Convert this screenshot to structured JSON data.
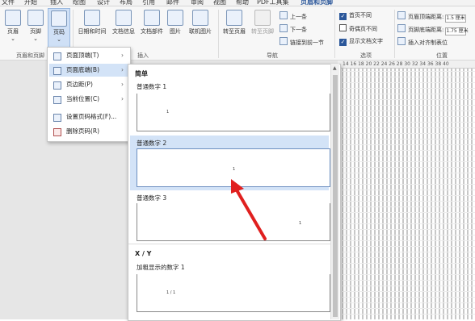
{
  "tabs": [
    "文件",
    "开始",
    "插入",
    "绘图",
    "设计",
    "布局",
    "引用",
    "邮件",
    "审阅",
    "视图",
    "帮助",
    "PDF工具集",
    "页眉和页脚"
  ],
  "ribbon": {
    "header_label": "页眉",
    "footer_label": "页脚",
    "page_number_label": "页码",
    "date_time_label": "日期和时间",
    "doc_info_label": "文档信息",
    "doc_parts_label": "文档部件",
    "picture_label": "图片",
    "online_picture_label": "联机图片",
    "goto_header_label": "转至页眉",
    "goto_footer_label": "转至页脚",
    "prev_label": "上一条",
    "next_label": "下一条",
    "link_prev_label": "链接到前一节",
    "first_page_diff_label": "首页不同",
    "odd_even_diff_label": "奇偶页不同",
    "show_doc_text_label": "显示文档文字",
    "header_top_label": "页眉顶端距离:",
    "header_top_value": "1.5 厘米",
    "footer_bottom_label": "页脚底端距离:",
    "footer_bottom_value": "1.75 厘米",
    "insert_align_tab_label": "插入对齐制表位",
    "group_header_footer": "页眉和页脚",
    "group_insert": "插入",
    "group_nav": "导航",
    "group_options": "选项",
    "group_position": "位置"
  },
  "menu": {
    "items": [
      {
        "label": "页面顶端(T)",
        "arrow": "›"
      },
      {
        "label": "页面底端(B)",
        "arrow": "›"
      },
      {
        "label": "页边距(P)",
        "arrow": "›"
      },
      {
        "label": "当前位置(C)",
        "arrow": "›"
      },
      {
        "label": "设置页码格式(F)...",
        "arrow": ""
      },
      {
        "label": "删除页码(R)",
        "arrow": ""
      }
    ]
  },
  "gallery": {
    "section1": "简单",
    "item1": "普通数字 1",
    "item2": "普通数字 2",
    "item3": "普通数字 3",
    "section2": "X / Y",
    "item4": "加粗显示的数字 1",
    "page_mark": "1",
    "xy_mark": "1 / 1"
  },
  "ruler": {
    "ticks": "14  16  18  20  22  24  26  28  30  32  34  36  38  40"
  },
  "colors": {
    "accent": "#2b579a",
    "arrow": "#e0201f",
    "selected": "#d3e3f7"
  }
}
